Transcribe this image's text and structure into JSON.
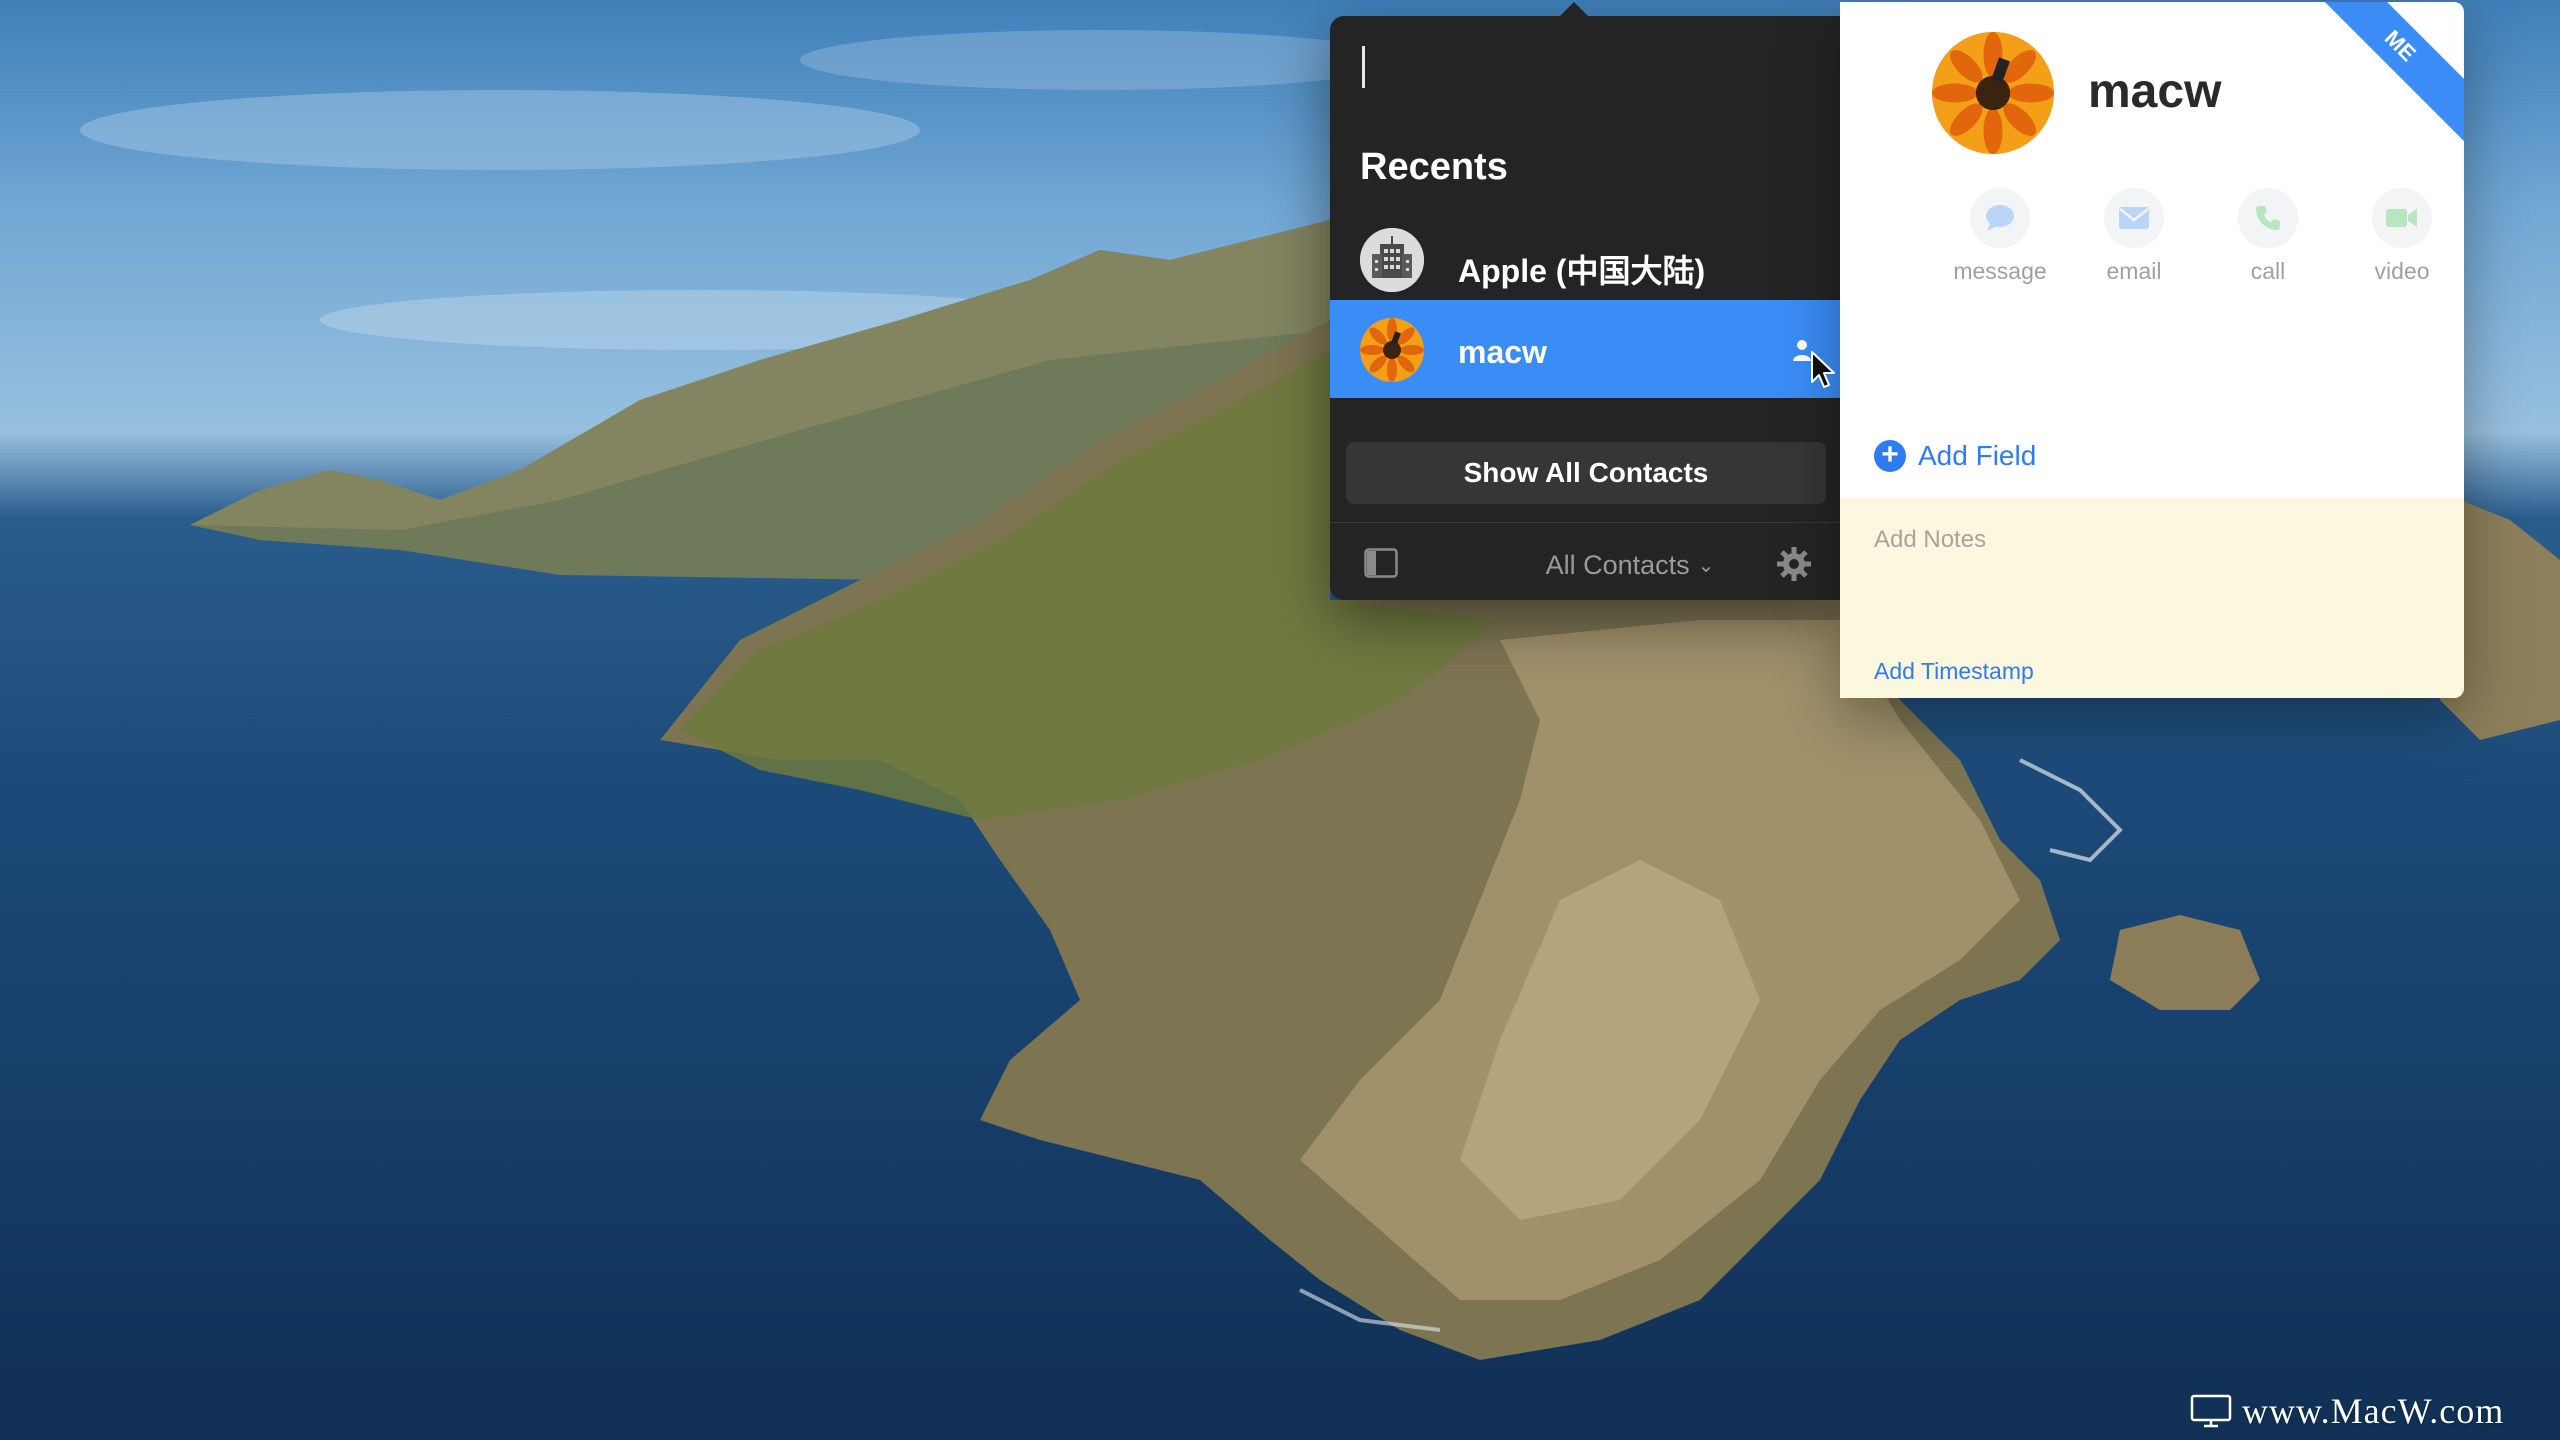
{
  "popover": {
    "search_value": "",
    "recents_heading": "Recents",
    "contacts": [
      {
        "name": "Apple (中国大陆)",
        "avatar_icon": "building-icon",
        "selected": false
      },
      {
        "name": "macw",
        "avatar_icon": "flower-photo",
        "selected": true
      }
    ],
    "show_all_label": "Show All Contacts",
    "filter_label": "All Contacts",
    "accent_color": "#3a8df7"
  },
  "card": {
    "badge": "ME",
    "name": "macw",
    "actions": [
      {
        "label": "message",
        "icon": "message-bubble-icon"
      },
      {
        "label": "email",
        "icon": "envelope-icon"
      },
      {
        "label": "call",
        "icon": "phone-icon"
      },
      {
        "label": "video",
        "icon": "video-camera-icon"
      }
    ],
    "add_field_label": "Add Field",
    "notes_placeholder": "Add Notes",
    "add_timestamp_label": "Add Timestamp"
  },
  "watermark": "www.MacW.com"
}
